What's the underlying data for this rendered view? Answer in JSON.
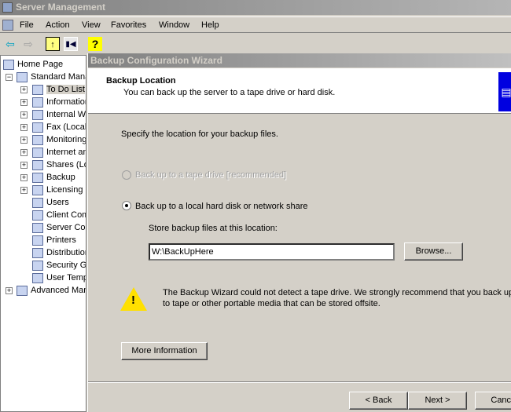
{
  "window": {
    "title": "Server Management"
  },
  "menu": [
    "File",
    "Action",
    "View",
    "Favorites",
    "Window",
    "Help"
  ],
  "toolbar": {
    "icons": [
      "back-arrow-icon",
      "forward-arrow-icon",
      "up-folder-icon",
      "show-hide-tree-icon",
      "help-icon"
    ]
  },
  "tree": [
    {
      "label": "Home Page",
      "level": 0
    },
    {
      "label": "Standard Management",
      "level": 0,
      "expanded": true
    },
    {
      "label": "To Do List",
      "level": 1,
      "expander": true,
      "selected": true
    },
    {
      "label": "Information Center",
      "level": 1,
      "expander": true
    },
    {
      "label": "Internal Web",
      "level": 1,
      "expander": true
    },
    {
      "label": "Fax (Local)",
      "level": 1,
      "expander": true
    },
    {
      "label": "Monitoring",
      "level": 1,
      "expander": true
    },
    {
      "label": "Internet and E-mail",
      "level": 1,
      "expander": true
    },
    {
      "label": "Shares (Local)",
      "level": 1,
      "expander": true
    },
    {
      "label": "Backup",
      "level": 1,
      "expander": true
    },
    {
      "label": "Licensing",
      "level": 1,
      "expander": true
    },
    {
      "label": "Users",
      "level": 1
    },
    {
      "label": "Client Computers",
      "level": 1
    },
    {
      "label": "Server Computers",
      "level": 1
    },
    {
      "label": "Printers",
      "level": 1
    },
    {
      "label": "Distribution Groups",
      "level": 1
    },
    {
      "label": "Security Groups",
      "level": 1
    },
    {
      "label": "User Templates",
      "level": 1
    },
    {
      "label": "Advanced Management",
      "level": 0,
      "expander": true
    }
  ],
  "wizard": {
    "title": "Backup Configuration Wizard",
    "heading": "Backup Location",
    "subheading": "You can back up the server to a tape drive or hard disk.",
    "instruction": "Specify the location for your backup files.",
    "option_tape": "Back up to a tape drive [recommended]",
    "option_disk": "Back up to a local hard disk or network share",
    "selected_option": "disk",
    "location_label": "Store backup files at this location:",
    "location_value": "W:\\BackUpHere",
    "browse": "Browse...",
    "warning_line1": "The Backup Wizard could not detect a tape drive. We strongly recommend that you back up",
    "warning_line2": "to tape or other portable media that can be stored offsite.",
    "more_info": "More Information",
    "back": "< Back",
    "next": "Next >",
    "cancel": "Cancel"
  }
}
